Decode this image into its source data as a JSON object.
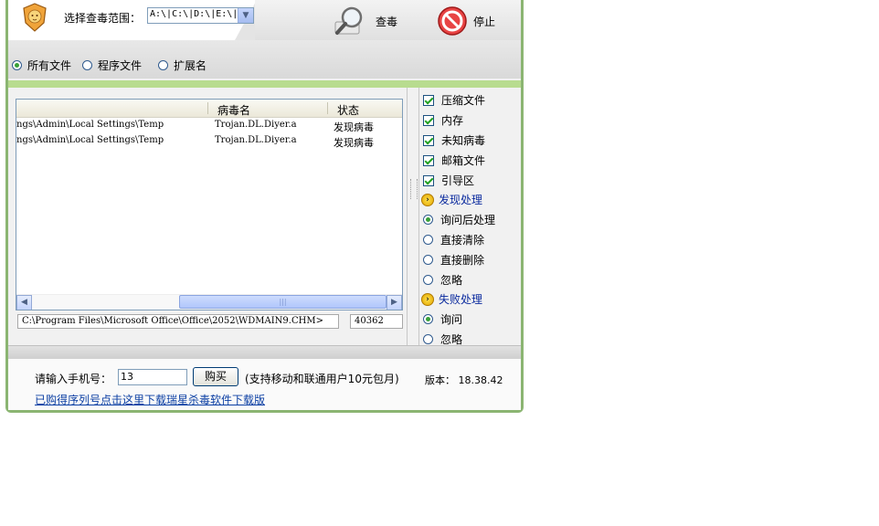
{
  "toolbar": {
    "scan_range_label": "选择查毒范围：",
    "scan_range_value": "A:\\|C:\\|D:\\|E:\\|",
    "scan_button": "查毒",
    "stop_button": "停止"
  },
  "filter": {
    "options": [
      "所有文件",
      "程序文件",
      "扩展名"
    ],
    "selected": "所有文件"
  },
  "results": {
    "columns": [
      "",
      "病毒名",
      "状态"
    ],
    "rows": [
      {
        "path": "ngs\\Admin\\Local Settings\\Temp",
        "virus": "Trojan.DL.Diyer.a",
        "status": "发现病毒"
      },
      {
        "path": "ngs\\Admin\\Local Settings\\Temp",
        "virus": "Trojan.DL.Diyer.a",
        "status": "发现病毒"
      }
    ]
  },
  "current": {
    "path": "C:\\Program Files\\Microsoft Office\\Office\\2052\\WDMAIN9.CHM>",
    "count": "40362"
  },
  "options": {
    "checks": [
      {
        "label": "压缩文件",
        "checked": true
      },
      {
        "label": "内存",
        "checked": true
      },
      {
        "label": "未知病毒",
        "checked": true
      },
      {
        "label": "邮箱文件",
        "checked": true
      },
      {
        "label": "引导区",
        "checked": true
      }
    ],
    "found_section": "发现处理",
    "found_options": [
      {
        "label": "询问后处理",
        "selected": true
      },
      {
        "label": "直接清除",
        "selected": false
      },
      {
        "label": "直接删除",
        "selected": false
      },
      {
        "label": "忽略",
        "selected": false
      }
    ],
    "fail_section": "失败处理",
    "fail_options": [
      {
        "label": "询问",
        "selected": true
      },
      {
        "label": "忽略",
        "selected": false
      }
    ]
  },
  "footer": {
    "phone_label": "请输入手机号：",
    "phone_value": "13",
    "buy_button": "购买",
    "buy_note": "(支持移动和联通用户10元包月)",
    "version_label": "版本：",
    "version_value": "18.38.42",
    "download_link": "已购得序列号点击这里下载瑞星杀毒软件下载版"
  },
  "colors": {
    "frame": "#8bb572",
    "accent_green": "#b8dc8f",
    "link": "#0a3ea3"
  }
}
